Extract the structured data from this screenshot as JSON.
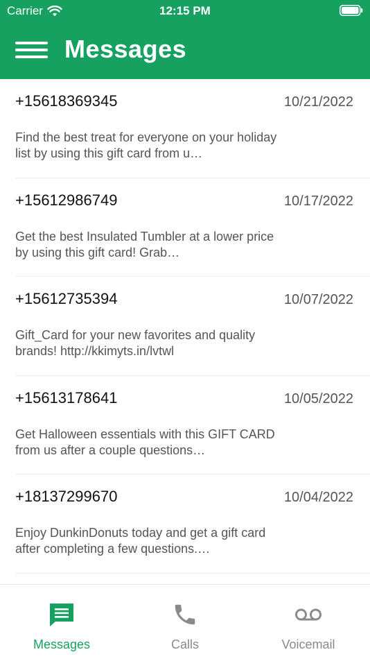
{
  "status_bar": {
    "carrier": "Carrier",
    "time": "12:15 PM"
  },
  "app_bar": {
    "title": "Messages"
  },
  "colors": {
    "accent": "#17a160",
    "inactive": "#8a8a8a"
  },
  "messages": [
    {
      "phone": "+15618369345",
      "date": "10/21/2022",
      "preview": "Find the best treat for everyone on your holiday list by using this gift card from u…"
    },
    {
      "phone": "+15612986749",
      "date": "10/17/2022",
      "preview": "Get the best Insulated Tumbler at a lower price by using this gift card! Grab…"
    },
    {
      "phone": "+15612735394",
      "date": "10/07/2022",
      "preview": "Gift_Card for your new favorites and quality brands! http://kkimyts.in/lvtwl"
    },
    {
      "phone": "+15613178641",
      "date": "10/05/2022",
      "preview": "Get Halloween essentials with this GIFT CARD from us after a couple questions…"
    },
    {
      "phone": "+18137299670",
      "date": "10/04/2022",
      "preview": "Enjoy DunkinDonuts today and get a gift card after completing a few questions.…"
    }
  ],
  "tabs": [
    {
      "label": "Messages",
      "icon": "messages-icon",
      "active": true
    },
    {
      "label": "Calls",
      "icon": "phone-icon",
      "active": false
    },
    {
      "label": "Voicemail",
      "icon": "voicemail-icon",
      "active": false
    }
  ]
}
